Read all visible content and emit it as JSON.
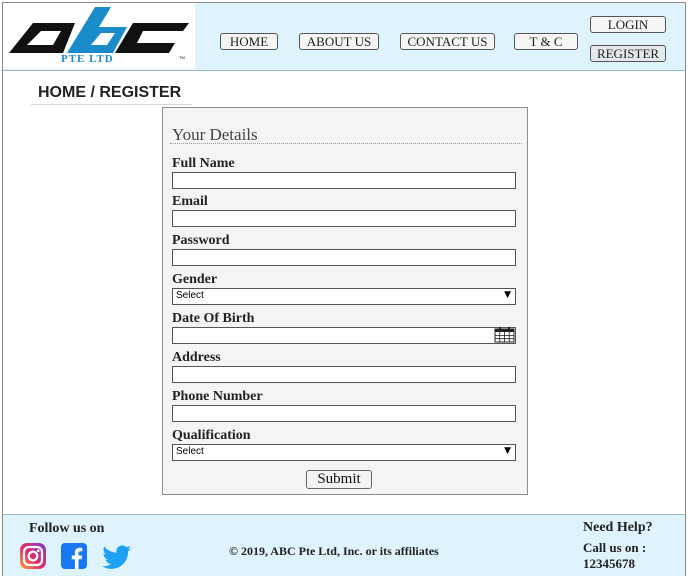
{
  "brand": {
    "logo_text": "abc",
    "company": "PTE LTD",
    "colors": {
      "blue": "#1a8cc9",
      "black": "#111111",
      "header_bg": "#def3fb"
    }
  },
  "nav": {
    "home": "HOME",
    "about": "ABOUT US",
    "contact": "CONTACT US",
    "terms": "T & C",
    "login": "LOGIN",
    "register": "REGISTER"
  },
  "breadcrumb": "HOME / REGISTER",
  "form": {
    "title": "Your Details",
    "full_name_label": "Full Name",
    "full_name_value": "",
    "email_label": "Email",
    "email_value": "",
    "password_label": "Password",
    "password_value": "",
    "gender_label": "Gender",
    "gender_selected": "Select",
    "dob_label": "Date Of Birth",
    "dob_value": "",
    "address_label": "Address",
    "address_value": "",
    "phone_label": "Phone Number",
    "phone_value": "",
    "qualification_label": "Qualification",
    "qualification_selected": "Select",
    "submit_label": "Submit"
  },
  "footer": {
    "follow_label": "Follow us on",
    "social_icons": [
      "instagram-icon",
      "facebook-icon",
      "twitter-icon"
    ],
    "copyright": "© 2019, ABC Pte Ltd, Inc. or its affiliates",
    "help_title": "Need Help?",
    "help_call": "Call us on :",
    "help_phone": "12345678"
  }
}
